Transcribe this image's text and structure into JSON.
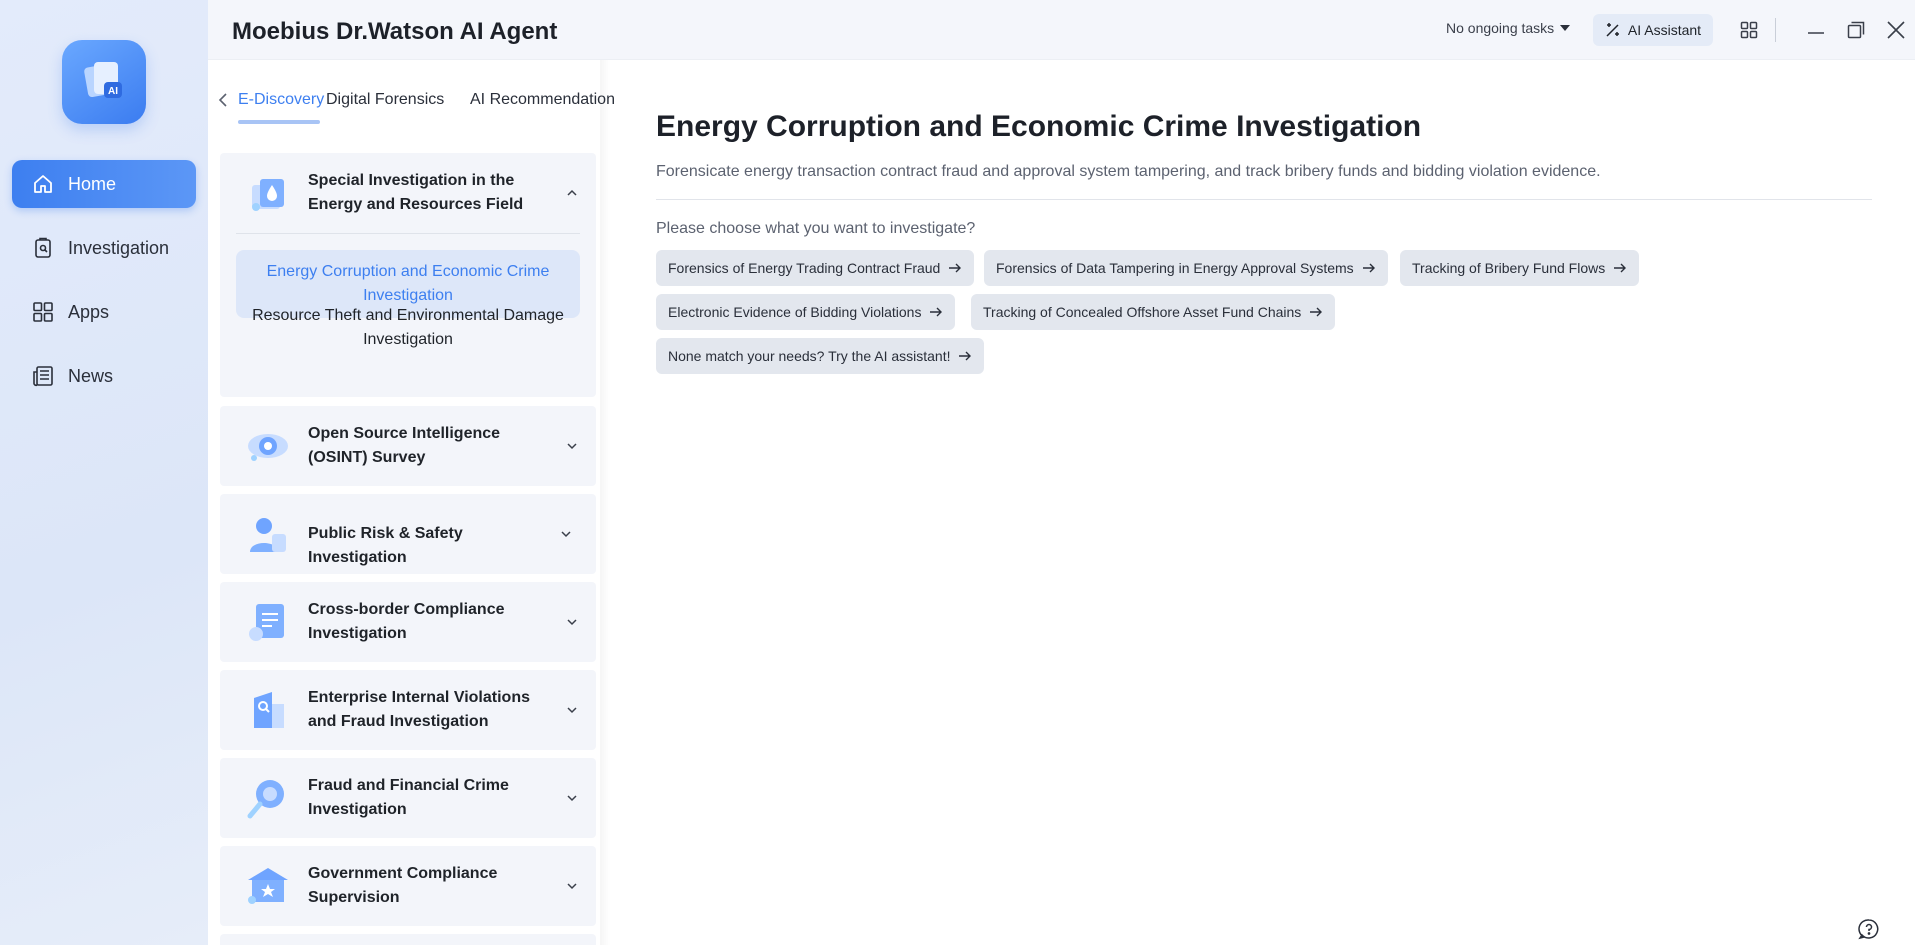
{
  "app": {
    "title": "Moebius Dr.Watson AI Agent"
  },
  "topbar": {
    "tasks_label": "No ongoing tasks",
    "ai_assistant_label": "AI Assistant"
  },
  "sidebar": {
    "items": [
      {
        "label": "Home",
        "icon": "home-icon",
        "active": true
      },
      {
        "label": "Investigation",
        "icon": "clipboard-icon",
        "active": false
      },
      {
        "label": "Apps",
        "icon": "grid-icon",
        "active": false
      },
      {
        "label": "News",
        "icon": "newspaper-icon",
        "active": false
      }
    ]
  },
  "tabs": [
    {
      "label": "E-Discovery",
      "active": true
    },
    {
      "label": "Digital Forensics",
      "active": false
    },
    {
      "label": "AI Recommendation",
      "active": false
    }
  ],
  "categories": [
    {
      "title": "Special Investigation in the Energy and Resources Field",
      "expanded": true,
      "icon": "energy-drop-icon",
      "subitems": [
        {
          "label": "Energy Corruption and Economic Crime Investigation",
          "active": true
        },
        {
          "label": "Resource Theft and Environmental Damage Investigation",
          "active": false
        }
      ]
    },
    {
      "title": "Open Source Intelligence (OSINT) Survey",
      "expanded": false,
      "icon": "eye-icon"
    },
    {
      "title": "Public Risk & Safety Investigation",
      "expanded": false,
      "icon": "person-shield-icon"
    },
    {
      "title": "Cross-border Compliance Investigation",
      "expanded": false,
      "icon": "document-globe-icon"
    },
    {
      "title": "Enterprise Internal Violations and Fraud Investigation",
      "expanded": false,
      "icon": "building-search-icon"
    },
    {
      "title": "Fraud and Financial Crime Investigation",
      "expanded": false,
      "icon": "magnifier-coin-icon"
    },
    {
      "title": "Government Compliance Supervision",
      "expanded": false,
      "icon": "government-building-icon"
    }
  ],
  "main": {
    "title": "Energy Corruption and Economic Crime Investigation",
    "description": "Forensicate energy transaction contract fraud and approval system tampering, and track bribery funds and bidding violation evidence.",
    "prompt": "Please choose what you want to investigate?",
    "options": [
      "Forensics of Energy Trading Contract Fraud",
      "Forensics of Data Tampering in Energy Approval Systems",
      "Tracking of Bribery Fund Flows",
      "Electronic Evidence of Bidding Violations",
      "Tracking of Concealed Offshore Asset Fund Chains",
      "None match your needs? Try the AI assistant!"
    ]
  },
  "colors": {
    "accent": "#3d7ff0",
    "rail_bg": "#dfe8f9",
    "chip_bg": "#e3e7ee",
    "card_bg": "#f3f5fa"
  }
}
